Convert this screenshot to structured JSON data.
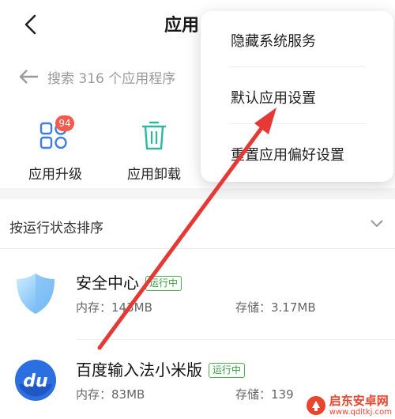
{
  "header": {
    "title": "应用",
    "back_icon": "back-chevron-icon"
  },
  "search": {
    "icon": "back-arrow-search-icon",
    "placeholder": "搜索 316 个应用程序"
  },
  "actions": [
    {
      "label": "应用升级",
      "icon": "grid-apps-icon",
      "badge": "94"
    },
    {
      "label": "应用卸载",
      "icon": "trash-icon"
    }
  ],
  "sort": {
    "label": "按运行状态排序",
    "icon": "chevron-down-icon"
  },
  "apps": [
    {
      "name": "安全中心",
      "tag": "运行中",
      "memory": "内存：143MB",
      "storage": "存储：3.17MB",
      "icon": "shield-icon"
    },
    {
      "name": "百度输入法小米版",
      "tag": "运行中",
      "memory": "内存：83MB",
      "storage": "存储：139",
      "icon": "du-icon"
    }
  ],
  "popup_menu": {
    "items": [
      "隐藏系统服务",
      "默认应用设置",
      "重置应用偏好设置"
    ]
  },
  "annotation": {
    "arrow_color": "#e53935"
  },
  "watermark": {
    "name": "启东安卓网",
    "url": "www.qdltkj.com"
  },
  "colors": {
    "accent_green": "#4caf50",
    "badge_red": "#f25b4d",
    "trash_teal": "#2bb8a0",
    "grid_blue": "#3d7fe0"
  }
}
